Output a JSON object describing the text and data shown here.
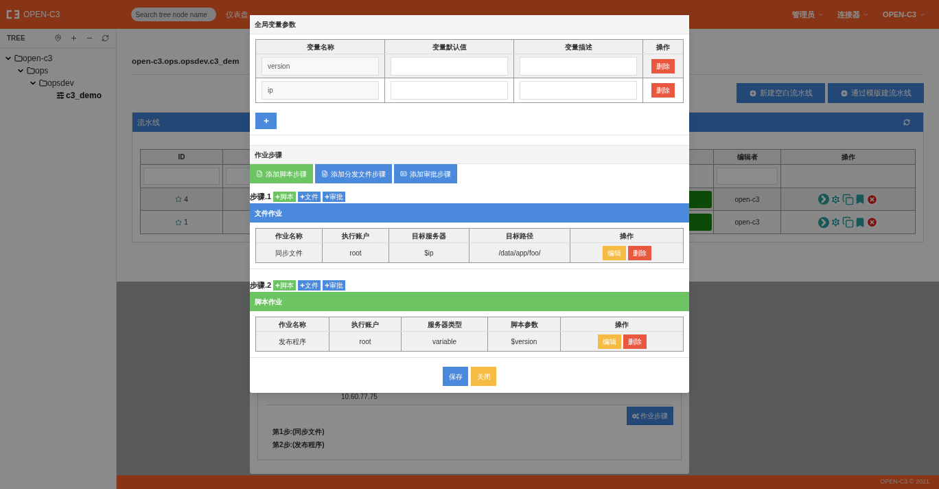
{
  "navbar": {
    "logo": "OPEN-C3",
    "search": {
      "placeholder": "Search tree node name"
    },
    "menu": [
      "仪表盘"
    ],
    "right_menu": [
      "管理员",
      "连接器",
      "OPEN-C3"
    ]
  },
  "sidebar": {
    "title": "TREE",
    "tree": [
      {
        "label": "open-c3",
        "kind": "folder",
        "expanded": true,
        "selected": false,
        "children": [
          {
            "label": "ops",
            "kind": "folder",
            "expanded": true,
            "selected": false,
            "children": [
              {
                "label": "opsdev",
                "kind": "folder",
                "expanded": true,
                "selected": false,
                "children": [
                  {
                    "label": "c3_demo",
                    "kind": "leaf",
                    "selected": true
                  }
                ]
              }
            ]
          }
        ]
      }
    ]
  },
  "page": {
    "title": "open-c3.ops.opsdev.c3_dem",
    "actions": [
      "新建空白流水线",
      "通过模版建流水线"
    ],
    "panel": {
      "title": "流水线",
      "columns": [
        "ID",
        "编辑者",
        "操作"
      ],
      "rows": [
        {
          "id": "4",
          "editor": "open-c3"
        },
        {
          "id": "1",
          "editor": "open-c3"
        }
      ]
    }
  },
  "back_dialog": {
    "server": "10.60.77.75",
    "button": "作业步骤",
    "steps": [
      "第1步:(同步文件)",
      "第2步:(发布程序)"
    ]
  },
  "dialog": {
    "variables": {
      "title": "全局变量参数",
      "columns": [
        "变量名称",
        "变量默认值",
        "变量描述",
        "操作"
      ],
      "rows": [
        {
          "name": "version",
          "delete": "删除"
        },
        {
          "name": "ip",
          "delete": "删除"
        }
      ]
    },
    "steps_title": "作业步骤",
    "add_buttons": [
      {
        "kind": "script",
        "label": "添加脚本步骤"
      },
      {
        "kind": "file",
        "label": "添加分发文件步骤"
      },
      {
        "kind": "approval",
        "label": "添加审批步骤"
      }
    ],
    "steps": [
      {
        "label": "步骤.1",
        "inserts": [
          {
            "kind": "script",
            "label": "脚本"
          },
          {
            "kind": "file",
            "label": "文件"
          },
          {
            "kind": "approval",
            "label": "审批"
          }
        ],
        "kind": "file",
        "title": "文件作业",
        "columns": [
          "作业名称",
          "执行账户",
          "目标服务器",
          "目标路径",
          "操作"
        ],
        "cells": [
          "同步文件",
          "root",
          "$ip",
          "/data/app/foo/"
        ],
        "actions": [
          {
            "kind": "edit",
            "label": "编辑"
          },
          {
            "kind": "delete",
            "label": "删除"
          }
        ]
      },
      {
        "label": "步骤.2",
        "inserts": [
          {
            "kind": "script",
            "label": "脚本"
          },
          {
            "kind": "file",
            "label": "文件"
          },
          {
            "kind": "approval",
            "label": "审批"
          }
        ],
        "kind": "script",
        "title": "脚本作业",
        "columns": [
          "作业名称",
          "执行账户",
          "服务器类型",
          "脚本参数",
          "操作"
        ],
        "cells": [
          "发布程序",
          "root",
          "variable",
          "$version"
        ],
        "actions": [
          {
            "kind": "edit",
            "label": "编辑"
          },
          {
            "kind": "delete",
            "label": "删除"
          }
        ]
      }
    ],
    "buttons": [
      {
        "kind": "save",
        "label": "保存"
      },
      {
        "kind": "close",
        "label": "关闭"
      }
    ]
  },
  "footer": "OPEN-C3 © 2021"
}
